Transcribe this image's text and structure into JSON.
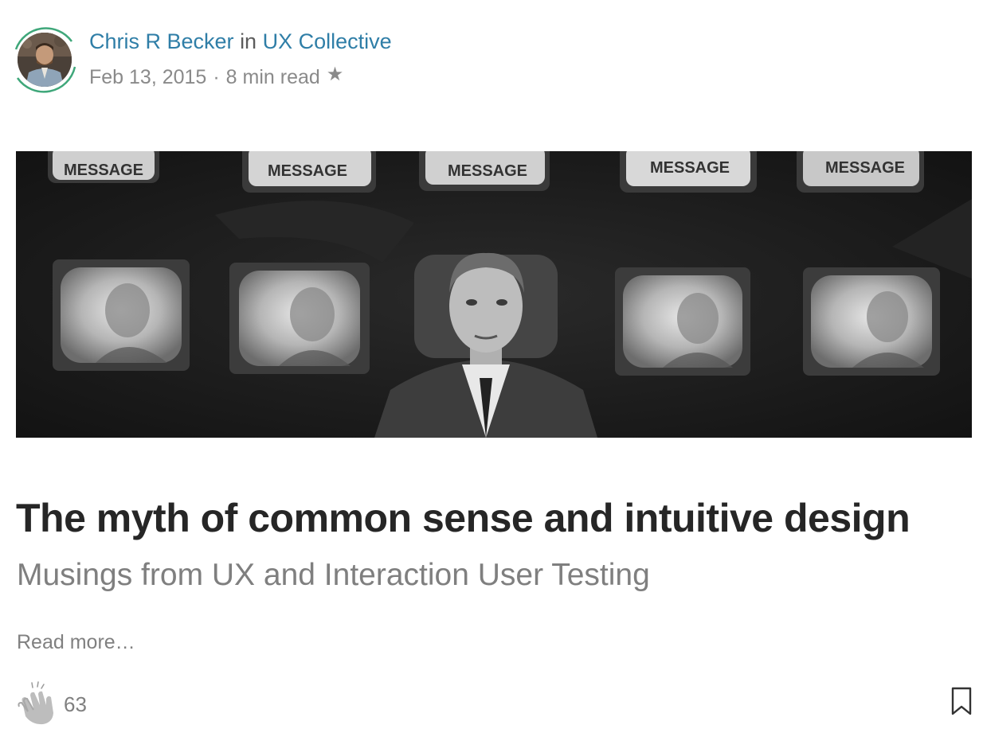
{
  "post": {
    "author_name": "Chris R Becker",
    "in_text": "in",
    "publication": "UX Collective",
    "date": "Feb 13, 2015",
    "separator": "·",
    "read_time": "8 min read",
    "star_icon": "star-icon",
    "title": "The myth of common sense and intuitive design",
    "subtitle": "Musings from UX and Interaction User Testing",
    "read_more": "Read more…",
    "claps": "63",
    "clap_icon": "clap-hands-icon",
    "bookmark_icon": "bookmark-icon"
  },
  "hero_image": {
    "monitor_caption": "MESSAGE"
  },
  "colors": {
    "link": "#2f7ea7",
    "avatar_ring": "#3fa77a",
    "title": "#262626",
    "muted": "#808080"
  }
}
